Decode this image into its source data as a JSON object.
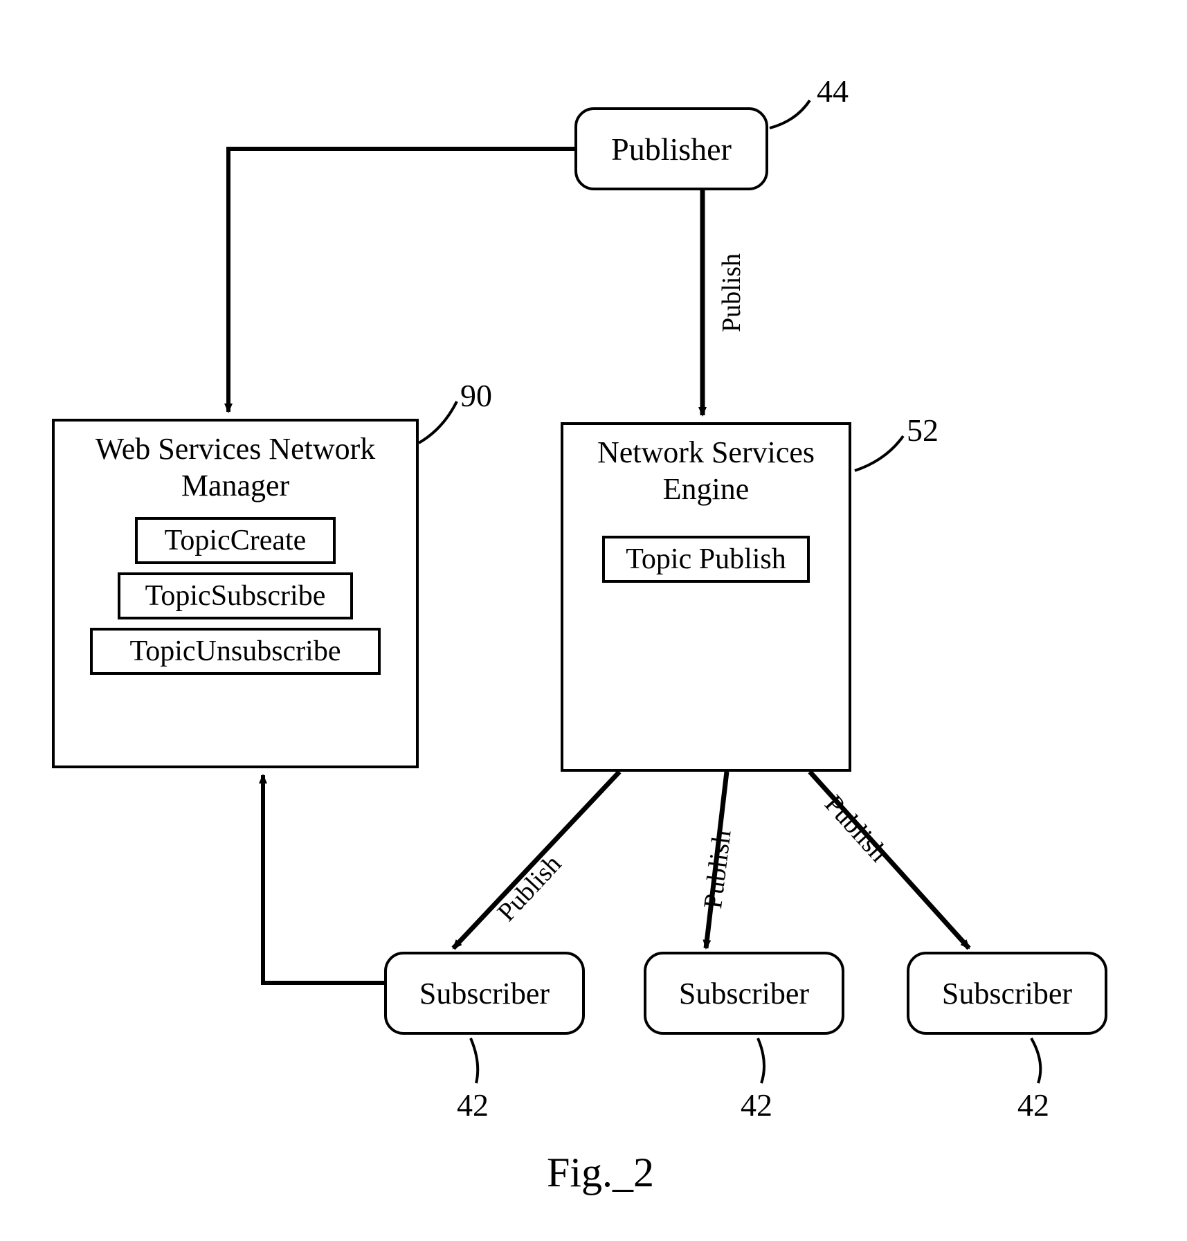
{
  "nodes": {
    "publisher": {
      "label": "Publisher",
      "ref": "44"
    },
    "wsnm": {
      "title_line1": "Web Services Network",
      "title_line2": "Manager",
      "topic_create": "TopicCreate",
      "topic_subscribe": "TopicSubscribe",
      "topic_unsubscribe": "TopicUnsubscribe",
      "ref": "90"
    },
    "nse": {
      "title_line1": "Network Services",
      "title_line2": "Engine",
      "topic_publish": "Topic Publish",
      "ref": "52"
    },
    "subscriber1": {
      "label": "Subscriber",
      "ref": "42"
    },
    "subscriber2": {
      "label": "Subscriber",
      "ref": "42"
    },
    "subscriber3": {
      "label": "Subscriber",
      "ref": "42"
    }
  },
  "edges": {
    "publish_down": "Publish",
    "publish_s1": "Publish",
    "publish_s2": "Publish",
    "publish_s3": "Publish"
  },
  "figure": "Fig._2"
}
